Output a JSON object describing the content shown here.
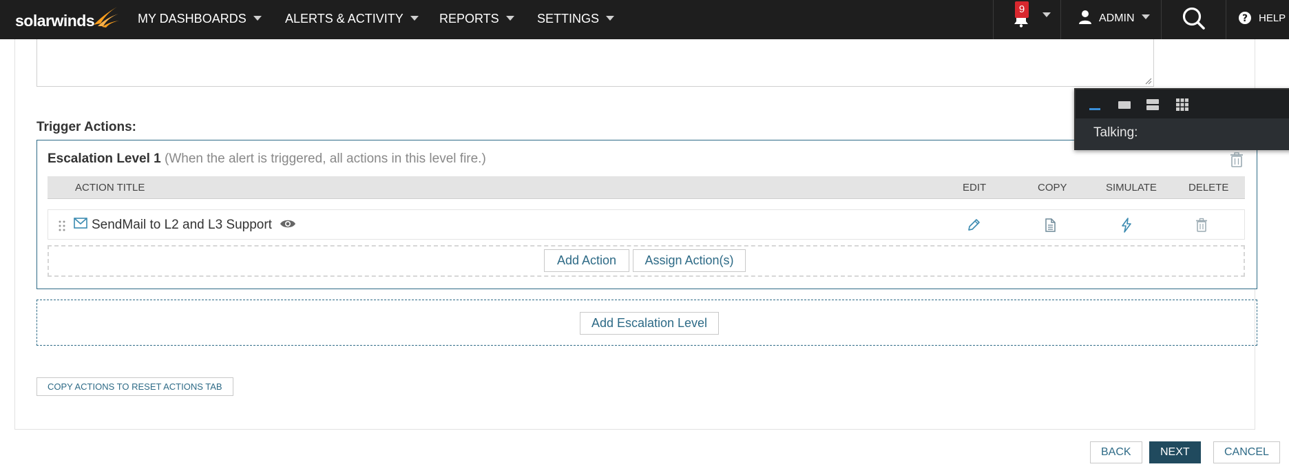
{
  "nav": {
    "logo_text": "solarwinds",
    "items": [
      {
        "label": "MY DASHBOARDS"
      },
      {
        "label": "ALERTS & ACTIVITY"
      },
      {
        "label": "REPORTS"
      },
      {
        "label": "SETTINGS"
      }
    ],
    "notification_count": "9",
    "user_label": "ADMIN",
    "help_label": "HELP",
    "icons": [
      "bell-icon",
      "user-icon",
      "search-icon",
      "help-icon"
    ],
    "accent_color": "#f99d1c"
  },
  "trigger": {
    "title": "Trigger Actions:"
  },
  "escalation": {
    "title": "Escalation Level 1",
    "subtitle": "(When the alert is triggered, all actions in this level fire.)",
    "columns": {
      "action_title": "ACTION TITLE",
      "edit": "EDIT",
      "copy": "COPY",
      "simulate": "SIMULATE",
      "delete": "DELETE"
    },
    "actions": [
      {
        "title": "SendMail to L2 and L3 Support",
        "type_icon": "mail-icon"
      }
    ],
    "add_action_label": "Add Action",
    "assign_action_label": "Assign Action(s)"
  },
  "add_escalation_label": "Add Escalation Level",
  "copy_actions_label": "COPY ACTIONS TO RESET ACTIONS TAB",
  "footer": {
    "back_label": "BACK",
    "next_label": "NEXT",
    "cancel_label": "CANCEL"
  },
  "talk_panel": {
    "label": "Talking:"
  },
  "colors": {
    "link_blue": "#2d6a86",
    "primary_button": "#204a5e",
    "badge_red": "#d9272e",
    "topbar": "#1e1e1e"
  }
}
